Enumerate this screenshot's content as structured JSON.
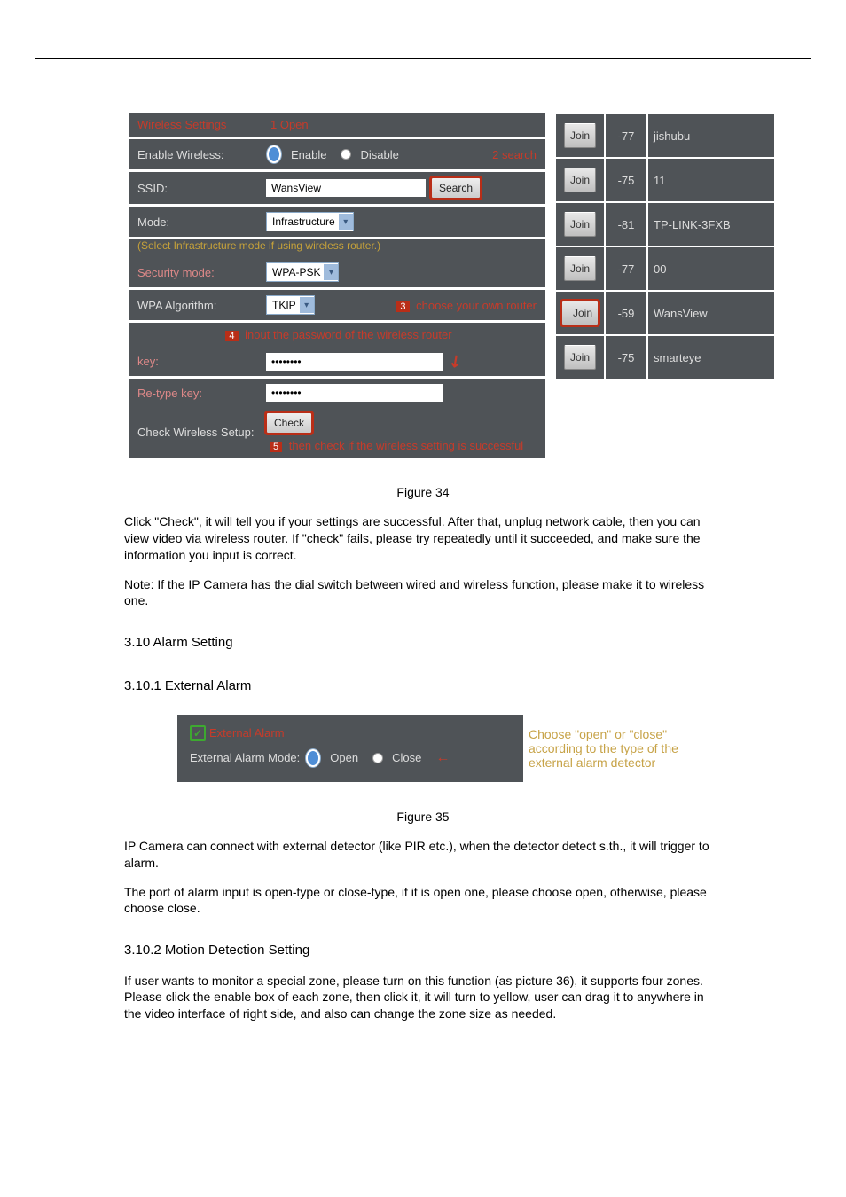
{
  "wireless_panel": {
    "title": "Wireless Settings",
    "open_tag": "1  Open",
    "enable_label": "Enable Wireless:",
    "enable_opt": "Enable",
    "disable_opt": "Disable",
    "search_tag": "2    search",
    "ssid_label": "SSID:",
    "ssid_value": "WansView",
    "search_btn": "Search",
    "mode_label": "Mode:",
    "mode_value": "Infrastructure",
    "infra_note": "(Select Infrastructure mode if using wireless router.)",
    "sec_label": "Security mode:",
    "sec_value": "WPA-PSK",
    "algo_label": "WPA Algorithm:",
    "algo_value": "TKIP",
    "choose_router_tag": "choose your own router",
    "key_instr_tag": "inout the password of the wireless router",
    "key_label": "key:",
    "key_value": "••••••••",
    "retype_label": "Re-type key:",
    "retype_value": "••••••••",
    "check_label": "Check Wireless Setup:",
    "check_btn": "Check",
    "check_note": "then check if the wireless setting is successful",
    "step3": "3",
    "step4": "4",
    "step5": "5"
  },
  "aps": [
    {
      "join": "Join",
      "sig": "-77",
      "name": "jishubu",
      "sel": false
    },
    {
      "join": "Join",
      "sig": "-75",
      "name": "11",
      "sel": false
    },
    {
      "join": "Join",
      "sig": "-81",
      "name": "TP-LINK-3FXB",
      "sel": false
    },
    {
      "join": "Join",
      "sig": "-77",
      "name": "00",
      "sel": false
    },
    {
      "join": "Join",
      "sig": "-59",
      "name": "WansView",
      "sel": true
    },
    {
      "join": "Join",
      "sig": "-75",
      "name": "smarteye",
      "sel": false
    }
  ],
  "prose": {
    "fig_label": "Figure 34",
    "p1": "Click \"Check\", it will tell you if your settings are successful. After that, unplug network cable, then you can view video via wireless router. If \"check\" fails, please try repeatedly until it succeeded, and make sure the information you input is correct.",
    "p2": "Note: If the IP Camera has the dial switch between wired and wireless function, please make it to wireless one.",
    "h_alarm": "3.10 Alarm Setting",
    "h_ext": "3.10.1 External Alarm"
  },
  "ext_alarm": {
    "title": "External Alarm",
    "mode_label": "External Alarm Mode:",
    "open": "Open",
    "close": "Close",
    "note": "Choose \"open\" or \"close\" according to the type of the external alarm detector"
  },
  "prose2": {
    "fig2": "Figure 35",
    "p1": "IP Camera can connect with external detector (like PIR etc.), when the detector detect s.th., it will trigger to alarm.",
    "p2": "The port of alarm input is open-type or close-type, if it is open one, please choose open, otherwise, please choose close.",
    "h_md": "3.10.2 Motion Detection Setting",
    "p3": "If user wants to monitor a special zone, please turn on this function (as picture 36), it supports four zones. Please click the enable box of each zone, then click it, it will turn to yellow, user can drag it to anywhere in the video interface of right side, and also can change the zone size as needed."
  }
}
